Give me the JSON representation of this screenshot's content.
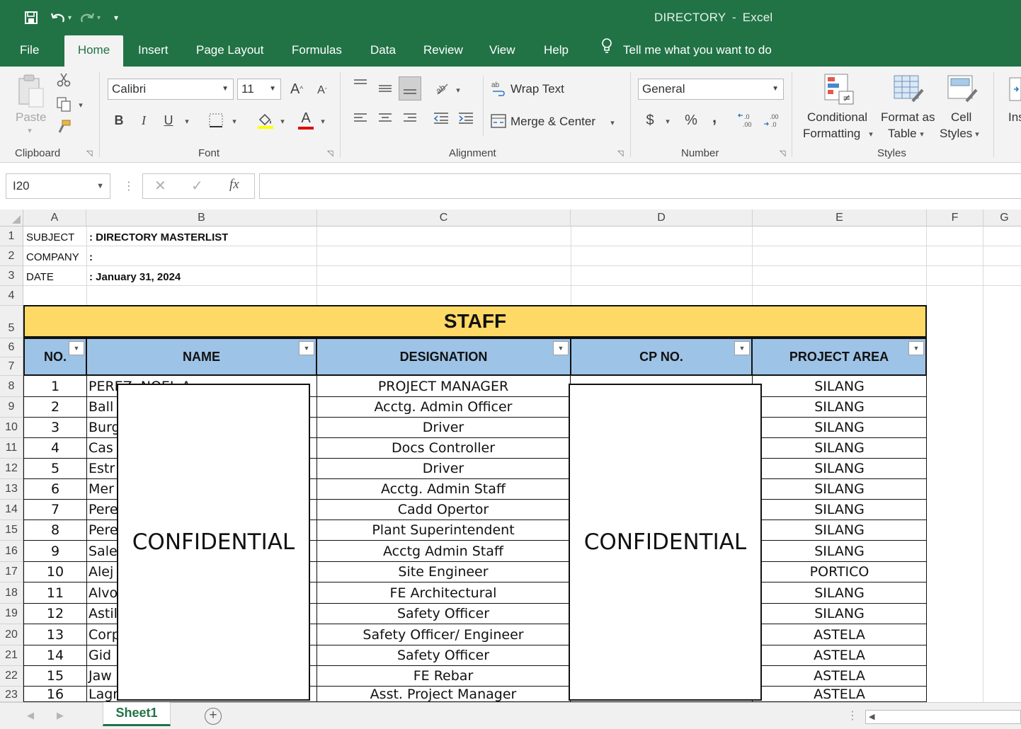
{
  "app": {
    "doc_title": "DIRECTORY",
    "separator": "-",
    "app_name": "Excel",
    "accent": "#217346"
  },
  "ribbon_tabs": [
    "File",
    "Home",
    "Insert",
    "Page Layout",
    "Formulas",
    "Data",
    "Review",
    "View",
    "Help"
  ],
  "active_tab": "Home",
  "tell_me": "Tell me what you want to do",
  "clipboard": {
    "paste": "Paste",
    "label": "Clipboard"
  },
  "font": {
    "name": "Calibri",
    "size": "11",
    "bold": "B",
    "italic": "I",
    "underline": "U",
    "grow": "A",
    "shrink": "A",
    "color_letter": "A",
    "label": "Font",
    "font_color": "#e00000",
    "fill_color": "#ffff00"
  },
  "alignment": {
    "wrap_text": "Wrap Text",
    "merge_center": "Merge & Center",
    "label": "Alignment"
  },
  "number": {
    "format": "General",
    "currency": "$",
    "percent": "%",
    "comma": ",",
    "label": "Number"
  },
  "styles": {
    "conditional_1": "Conditional",
    "conditional_2": "Formatting",
    "format_as_1": "Format as",
    "format_as_2": "Table",
    "cell_1": "Cell",
    "cell_2": "Styles",
    "label": "Styles",
    "insert_partial": "Ins"
  },
  "formula_bar": {
    "name_box": "I20",
    "fx": "fx",
    "value": ""
  },
  "columns": [
    "A",
    "B",
    "C",
    "D",
    "E",
    "F",
    "G"
  ],
  "row_numbers": [
    "1",
    "2",
    "3",
    "4",
    "5",
    "6",
    "7",
    "8",
    "9",
    "10",
    "11",
    "12",
    "13",
    "14",
    "15",
    "16",
    "17",
    "18",
    "19",
    "20",
    "21",
    "22",
    "23"
  ],
  "header_info": {
    "subject_label": "SUBJECT",
    "subject_value": ": DIRECTORY MASTERLIST",
    "company_label": "COMPANY",
    "company_value": ": ",
    "date_label": "DATE",
    "date_value": ": January 31, 2024"
  },
  "table": {
    "title": "STAFF",
    "headers": {
      "no": "NO.",
      "name": "NAME",
      "designation": "DESIGNATION",
      "cp": "CP NO.",
      "area": "PROJECT AREA"
    },
    "header_color": "#9dc3e6",
    "title_color": "#ffd966",
    "rows": [
      {
        "no": "1",
        "name": "PEREZ, NOEL A.",
        "designation": "PROJECT MANAGER",
        "area": "SILANG"
      },
      {
        "no": "2",
        "name": "Ball",
        "designation": "Acctg. Admin Officer",
        "area": "SILANG"
      },
      {
        "no": "3",
        "name": "Burg",
        "designation": "Driver",
        "area": "SILANG"
      },
      {
        "no": "4",
        "name": "Cas",
        "designation": "Docs Controller",
        "area": "SILANG"
      },
      {
        "no": "5",
        "name": "Estr",
        "designation": "Driver",
        "area": "SILANG"
      },
      {
        "no": "6",
        "name": "Mer",
        "designation": "Acctg. Admin Staff",
        "area": "SILANG"
      },
      {
        "no": "7",
        "name": "Pere",
        "designation": "Cadd Opertor",
        "area": "SILANG"
      },
      {
        "no": "8",
        "name": "Pere",
        "designation": "Plant Superintendent",
        "area": "SILANG"
      },
      {
        "no": "9",
        "name": "Sale",
        "designation": "Acctg Admin Staff",
        "area": "SILANG"
      },
      {
        "no": "10",
        "name": "Alej",
        "designation": "Site Engineer",
        "area": "PORTICO"
      },
      {
        "no": "11",
        "name": "Alvo",
        "designation": "FE Architectural",
        "area": "SILANG"
      },
      {
        "no": "12",
        "name": "Astil",
        "designation": "Safety Officer",
        "area": "SILANG"
      },
      {
        "no": "13",
        "name": "Corp",
        "designation": "Safety Officer/ Engineer",
        "area": "ASTELA"
      },
      {
        "no": "14",
        "name": "Gid",
        "designation": "Safety Officer",
        "area": "ASTELA"
      },
      {
        "no": "15",
        "name": "Jaw",
        "designation": "FE Rebar",
        "area": "ASTELA"
      },
      {
        "no": "16",
        "name": "Lagman, Michelle Basilio",
        "designation": "Asst. Project Manager",
        "area": "ASTELA"
      }
    ]
  },
  "redactions": {
    "name_box": "CONFIDENTIAL",
    "cp_box": "CONFIDENTIAL"
  },
  "sheet_tabs": [
    "Sheet1"
  ]
}
